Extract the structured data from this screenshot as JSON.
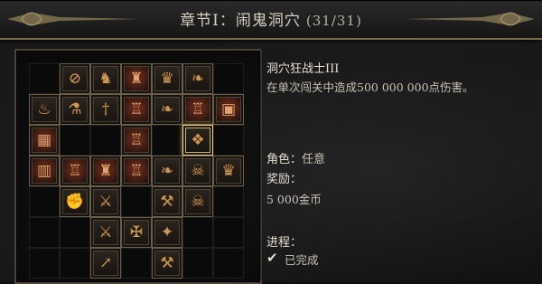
{
  "window": {
    "title": "章节I：闹鬼洞穴",
    "progress": "(31/31)"
  },
  "achievement": {
    "name": "洞穴狂战士III",
    "description": "在单次闯关中造成500 000 000点伤害。",
    "role_label": "角色：",
    "role_value": "任意",
    "reward_label": "奖励：",
    "reward_value": "5 000金币",
    "progress_label": "进程：",
    "status_icon": "checkmark-icon",
    "status_text": "已完成"
  },
  "grid": {
    "rows": [
      [
        "empty",
        "disabled-icon",
        "knight-icon",
        "helm-icon",
        "crown-icon",
        "boot-icon",
        "empty"
      ],
      [
        "flame-icon",
        "flask-icon",
        "blade-icon",
        "armor-icon",
        "boot-icon",
        "armor-icon",
        "chest-icon"
      ],
      [
        "hive-icon",
        "empty",
        "empty",
        "armor-icon",
        "empty",
        "selected-trophy-icon",
        "empty"
      ],
      [
        "pillar-icon",
        "armor-icon",
        "helm-icon",
        "armor-icon",
        "boot-icon",
        "demon-icon",
        "crown-icon"
      ],
      [
        "empty",
        "fist-icon",
        "sword-icon",
        "empty",
        "axe-icon",
        "demon-icon",
        "empty"
      ],
      [
        "empty",
        "empty",
        "sword-icon",
        "cross-icon",
        "star-icon",
        "empty",
        "empty"
      ],
      [
        "empty",
        "empty",
        "spear-icon",
        "empty",
        "axe-icon",
        "empty",
        "empty"
      ]
    ]
  },
  "colors": {
    "accent_gold": "#c8b06a",
    "text_primary": "#e6e0d4",
    "text_secondary": "#c9c3b6"
  }
}
